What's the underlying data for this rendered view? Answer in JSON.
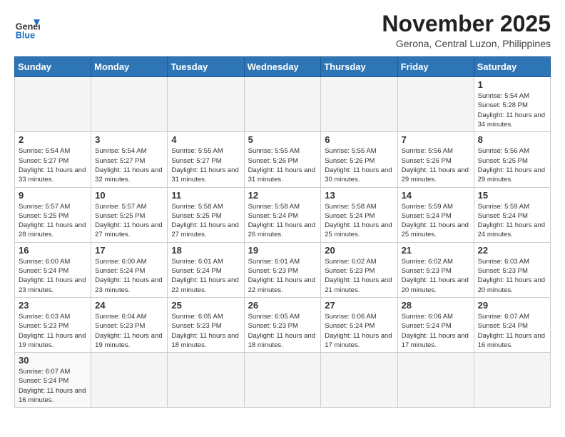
{
  "header": {
    "logo": {
      "general": "General",
      "blue": "Blue"
    },
    "title": "November 2025",
    "location": "Gerona, Central Luzon, Philippines"
  },
  "weekdays": [
    "Sunday",
    "Monday",
    "Tuesday",
    "Wednesday",
    "Thursday",
    "Friday",
    "Saturday"
  ],
  "weeks": [
    [
      {
        "day": "",
        "empty": true
      },
      {
        "day": "",
        "empty": true
      },
      {
        "day": "",
        "empty": true
      },
      {
        "day": "",
        "empty": true
      },
      {
        "day": "",
        "empty": true
      },
      {
        "day": "",
        "empty": true
      },
      {
        "day": "1",
        "sunrise": "5:54 AM",
        "sunset": "5:28 PM",
        "daylight": "11 hours and 34 minutes."
      }
    ],
    [
      {
        "day": "2",
        "sunrise": "5:54 AM",
        "sunset": "5:27 PM",
        "daylight": "11 hours and 33 minutes."
      },
      {
        "day": "3",
        "sunrise": "5:54 AM",
        "sunset": "5:27 PM",
        "daylight": "11 hours and 32 minutes."
      },
      {
        "day": "4",
        "sunrise": "5:55 AM",
        "sunset": "5:27 PM",
        "daylight": "11 hours and 31 minutes."
      },
      {
        "day": "5",
        "sunrise": "5:55 AM",
        "sunset": "5:26 PM",
        "daylight": "11 hours and 31 minutes."
      },
      {
        "day": "6",
        "sunrise": "5:55 AM",
        "sunset": "5:26 PM",
        "daylight": "11 hours and 30 minutes."
      },
      {
        "day": "7",
        "sunrise": "5:56 AM",
        "sunset": "5:26 PM",
        "daylight": "11 hours and 29 minutes."
      },
      {
        "day": "8",
        "sunrise": "5:56 AM",
        "sunset": "5:25 PM",
        "daylight": "11 hours and 29 minutes."
      }
    ],
    [
      {
        "day": "9",
        "sunrise": "5:57 AM",
        "sunset": "5:25 PM",
        "daylight": "11 hours and 28 minutes."
      },
      {
        "day": "10",
        "sunrise": "5:57 AM",
        "sunset": "5:25 PM",
        "daylight": "11 hours and 27 minutes."
      },
      {
        "day": "11",
        "sunrise": "5:58 AM",
        "sunset": "5:25 PM",
        "daylight": "11 hours and 27 minutes."
      },
      {
        "day": "12",
        "sunrise": "5:58 AM",
        "sunset": "5:24 PM",
        "daylight": "11 hours and 26 minutes."
      },
      {
        "day": "13",
        "sunrise": "5:58 AM",
        "sunset": "5:24 PM",
        "daylight": "11 hours and 25 minutes."
      },
      {
        "day": "14",
        "sunrise": "5:59 AM",
        "sunset": "5:24 PM",
        "daylight": "11 hours and 25 minutes."
      },
      {
        "day": "15",
        "sunrise": "5:59 AM",
        "sunset": "5:24 PM",
        "daylight": "11 hours and 24 minutes."
      }
    ],
    [
      {
        "day": "16",
        "sunrise": "6:00 AM",
        "sunset": "5:24 PM",
        "daylight": "11 hours and 23 minutes."
      },
      {
        "day": "17",
        "sunrise": "6:00 AM",
        "sunset": "5:24 PM",
        "daylight": "11 hours and 23 minutes."
      },
      {
        "day": "18",
        "sunrise": "6:01 AM",
        "sunset": "5:24 PM",
        "daylight": "11 hours and 22 minutes."
      },
      {
        "day": "19",
        "sunrise": "6:01 AM",
        "sunset": "5:23 PM",
        "daylight": "11 hours and 22 minutes."
      },
      {
        "day": "20",
        "sunrise": "6:02 AM",
        "sunset": "5:23 PM",
        "daylight": "11 hours and 21 minutes."
      },
      {
        "day": "21",
        "sunrise": "6:02 AM",
        "sunset": "5:23 PM",
        "daylight": "11 hours and 20 minutes."
      },
      {
        "day": "22",
        "sunrise": "6:03 AM",
        "sunset": "5:23 PM",
        "daylight": "11 hours and 20 minutes."
      }
    ],
    [
      {
        "day": "23",
        "sunrise": "6:03 AM",
        "sunset": "5:23 PM",
        "daylight": "11 hours and 19 minutes."
      },
      {
        "day": "24",
        "sunrise": "6:04 AM",
        "sunset": "5:23 PM",
        "daylight": "11 hours and 19 minutes."
      },
      {
        "day": "25",
        "sunrise": "6:05 AM",
        "sunset": "5:23 PM",
        "daylight": "11 hours and 18 minutes."
      },
      {
        "day": "26",
        "sunrise": "6:05 AM",
        "sunset": "5:23 PM",
        "daylight": "11 hours and 18 minutes."
      },
      {
        "day": "27",
        "sunrise": "6:06 AM",
        "sunset": "5:24 PM",
        "daylight": "11 hours and 17 minutes."
      },
      {
        "day": "28",
        "sunrise": "6:06 AM",
        "sunset": "5:24 PM",
        "daylight": "11 hours and 17 minutes."
      },
      {
        "day": "29",
        "sunrise": "6:07 AM",
        "sunset": "5:24 PM",
        "daylight": "11 hours and 16 minutes."
      }
    ],
    [
      {
        "day": "30",
        "sunrise": "6:07 AM",
        "sunset": "5:24 PM",
        "daylight": "11 hours and 16 minutes."
      },
      {
        "day": "",
        "empty": true
      },
      {
        "day": "",
        "empty": true
      },
      {
        "day": "",
        "empty": true
      },
      {
        "day": "",
        "empty": true
      },
      {
        "day": "",
        "empty": true
      },
      {
        "day": "",
        "empty": true
      }
    ]
  ]
}
